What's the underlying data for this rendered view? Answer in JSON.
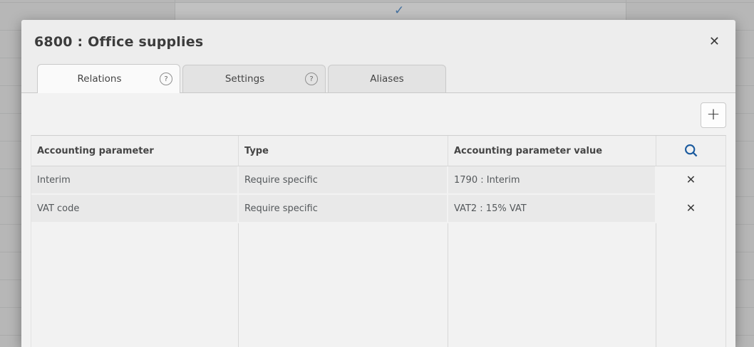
{
  "background": {
    "check_icon": "✓"
  },
  "dialog": {
    "title": "6800 : Office supplies",
    "tabs": [
      {
        "label": "Relations",
        "has_help": true,
        "active": true
      },
      {
        "label": "Settings",
        "has_help": true,
        "active": false
      },
      {
        "label": "Aliases",
        "has_help": false,
        "active": false
      }
    ],
    "table": {
      "columns": [
        "Accounting parameter",
        "Type",
        "Accounting parameter value"
      ],
      "rows": [
        {
          "parameter": "Interim",
          "type": "Require specific",
          "value": "1790 : Interim"
        },
        {
          "parameter": "VAT code",
          "type": "Require specific",
          "value": "VAT2 : 15% VAT"
        }
      ]
    }
  },
  "icons": {
    "close": "✕",
    "delete": "✕",
    "add": "+",
    "help": "?"
  },
  "colors": {
    "accent_blue": "#1a5a9e",
    "dialog_bg": "#ededed",
    "content_bg": "#f2f2f2",
    "row_bg": "#e9e9e9",
    "overlay_bg": "#b7b7b7"
  }
}
